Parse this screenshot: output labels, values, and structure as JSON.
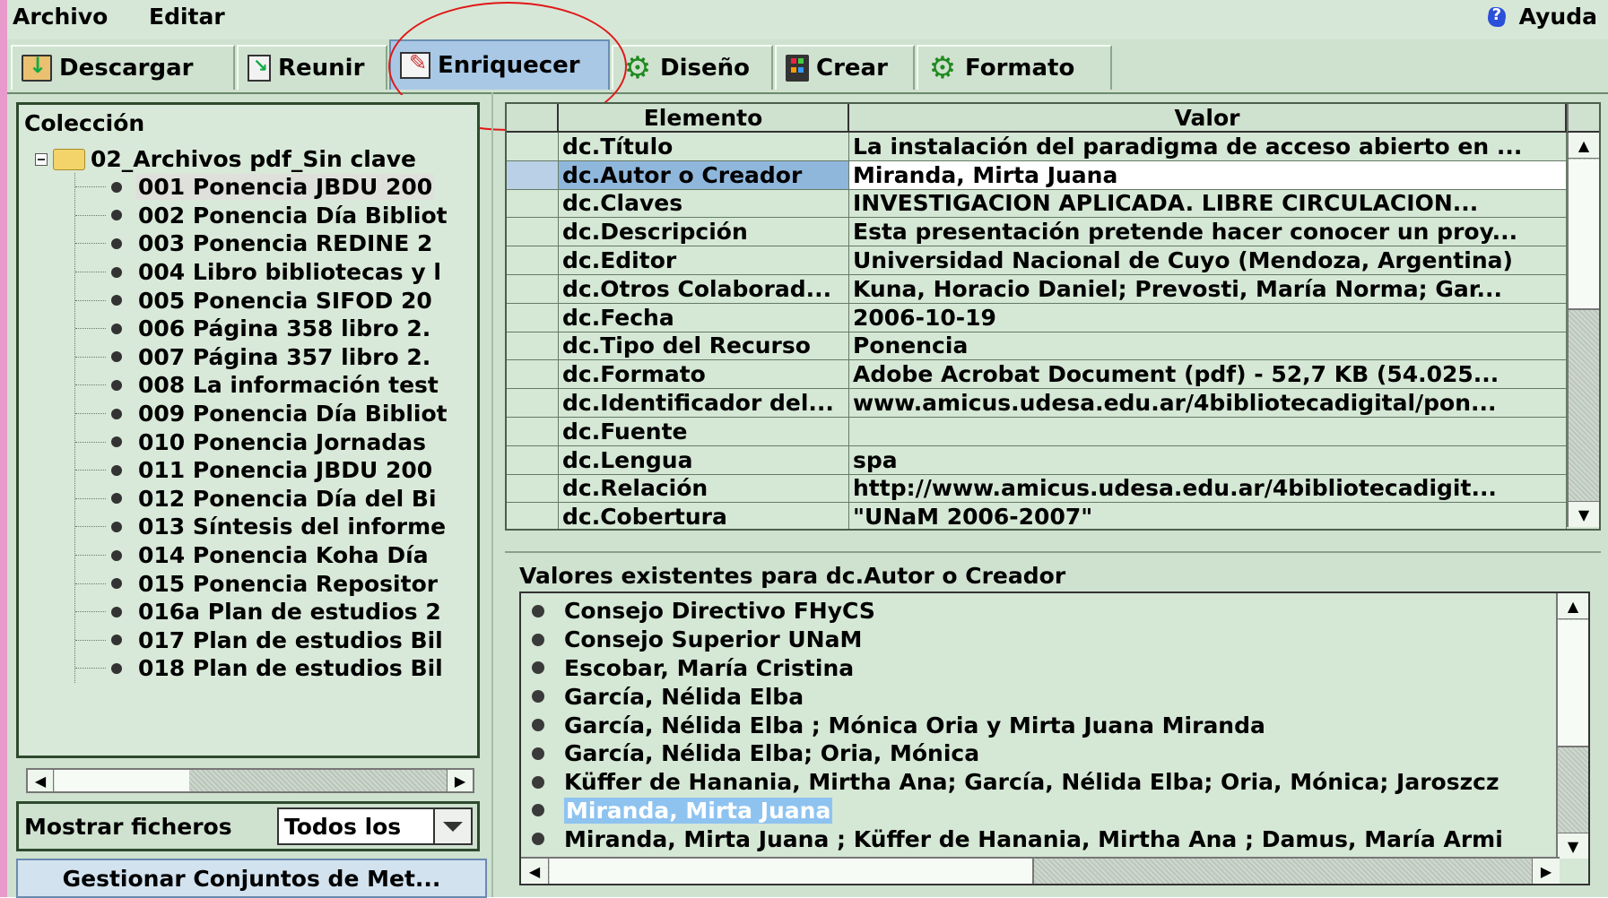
{
  "menu": {
    "archivo": "Archivo",
    "editar": "Editar",
    "ayuda": "Ayuda"
  },
  "tabs": [
    {
      "label": "Descargar",
      "icon": "download-icon"
    },
    {
      "label": "Reunir",
      "icon": "gather-icon"
    },
    {
      "label": "Enriquecer",
      "icon": "enrich-icon"
    },
    {
      "label": "Diseño",
      "icon": "gear-icon"
    },
    {
      "label": "Crear",
      "icon": "build-icon"
    },
    {
      "label": "Formato",
      "icon": "gear-icon"
    }
  ],
  "active_tab": "Enriquecer",
  "collection": {
    "title": "Colección",
    "root": "02_Archivos pdf_Sin clave",
    "items": [
      "001 Ponencia JBDU 200",
      "002 Ponencia Día Bibliot",
      "003 Ponencia REDINE 2",
      "004 Libro bibliotecas y l",
      "005 Ponencia SIFOD 20",
      "006 Página 358 libro 2.",
      "007 Página 357 libro 2.",
      "008 La información test",
      "009 Ponencia Día Bibliot",
      "010 Ponencia Jornadas",
      "011 Ponencia JBDU 200",
      "012 Ponencia Día del Bi",
      "013 Síntesis del informe",
      "014 Ponencia Koha Día",
      "015 Ponencia Repositor",
      "016a Plan de estudios 2",
      "017 Plan de estudios Bil",
      "018 Plan de estudios Bil"
    ],
    "selected_index": 0
  },
  "filter": {
    "label": "Mostrar ficheros",
    "value": "Todos los"
  },
  "manage_button": "Gestionar Conjuntos de Met...",
  "metadata": {
    "headers": [
      "Elemento",
      "Valor"
    ],
    "rows": [
      {
        "element": "dc.Título",
        "value": "La instalación del paradigma de acceso abierto en ..."
      },
      {
        "element": "dc.Autor o Creador",
        "value": "Miranda, Mirta Juana"
      },
      {
        "element": "dc.Claves",
        "value": "INVESTIGACION APLICADA. LIBRE CIRCULACION..."
      },
      {
        "element": "dc.Descripción",
        "value": "Esta presentación pretende hacer conocer un proy..."
      },
      {
        "element": "dc.Editor",
        "value": "Universidad Nacional de Cuyo (Mendoza, Argentina)"
      },
      {
        "element": "dc.Otros Colaborad...",
        "value": "Kuna, Horacio Daniel; Prevosti, María Norma; Gar..."
      },
      {
        "element": "dc.Fecha",
        "value": "2006-10-19"
      },
      {
        "element": "dc.Tipo del Recurso",
        "value": "Ponencia"
      },
      {
        "element": "dc.Formato",
        "value": "Adobe Acrobat Document (pdf) - 52,7 KB (54.025..."
      },
      {
        "element": "dc.Identificador del...",
        "value": "www.amicus.udesa.edu.ar/4bibliotecadigital/pon..."
      },
      {
        "element": "dc.Fuente",
        "value": ""
      },
      {
        "element": "dc.Lengua",
        "value": "spa"
      },
      {
        "element": "dc.Relación",
        "value": "http://www.amicus.udesa.edu.ar/4bibliotecadigit..."
      },
      {
        "element": "dc.Cobertura",
        "value": "\"UNaM 2006-2007\""
      }
    ],
    "selected_index": 1
  },
  "existing_values": {
    "title": "Valores existentes para dc.Autor o Creador",
    "items": [
      "Consejo Directivo FHyCS",
      "Consejo Superior UNaM",
      "Escobar, María Cristina",
      "García, Nélida Elba",
      "García, Nélida Elba ; Mónica Oria y Mirta Juana Miranda",
      "García, Nélida Elba; Oria, Mónica",
      "Küffer de Hanania, Mirtha Ana; García, Nélida Elba; Oria, Mónica; Jaroszcz",
      "Miranda, Mirta Juana",
      "Miranda, Mirta Juana ; Küffer de Hanania, Mirtha Ana ; Damus, María Armi"
    ],
    "selected_index": 7
  },
  "colors": {
    "app_background": "#cfe1cf",
    "active_tab": "#a9c8e6",
    "selected_value": "#8ec3f0",
    "annotation_circle": "#e01818"
  }
}
